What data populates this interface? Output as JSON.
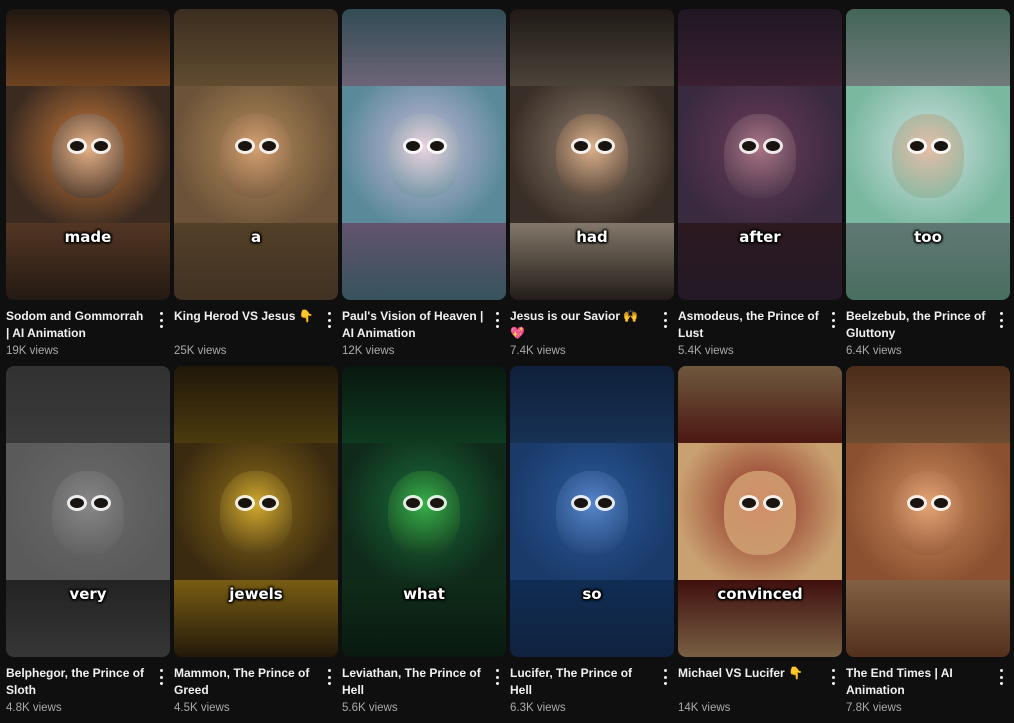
{
  "videos": [
    {
      "title": "Sodom and Gommorrah | AI Animation",
      "title_emoji": "",
      "views": "19K views",
      "caption": "made",
      "palette": [
        "#3a2a20",
        "#c97a3a",
        "#8a5a3a"
      ],
      "face": "#e8b890"
    },
    {
      "title": "King Herod VS Jesus",
      "title_emoji": "👇",
      "views": "25K views",
      "caption": "a",
      "palette": [
        "#6b5238",
        "#b08a58",
        "#8a6a44"
      ],
      "face": "#d9a373"
    },
    {
      "title": "Paul's Vision of Heaven | AI Animation",
      "title_emoji": "",
      "views": "12K views",
      "caption": "",
      "palette": [
        "#5a8a9a",
        "#c7b7d9",
        "#a58ab8"
      ],
      "face": "#f0d6e0"
    },
    {
      "title": "Jesus is our Savior",
      "title_emoji": "🙌 💖",
      "views": "7.4K views",
      "caption": "had",
      "palette": [
        "#3a2f28",
        "#8a7a6a",
        "#d9c7b0"
      ],
      "face": "#e6b890"
    },
    {
      "title": "Asmodeus, the Prince of Lust",
      "title_emoji": "",
      "views": "5.4K views",
      "caption": "after",
      "palette": [
        "#3a2a40",
        "#6a3a5a",
        "#4a2a35"
      ],
      "face": "#b07a8a"
    },
    {
      "title": "Beelzebub, the Prince of Gluttony",
      "title_emoji": "",
      "views": "6.4K views",
      "caption": "too",
      "palette": [
        "#7ab8a0",
        "#cfe0e0",
        "#a0c8c0"
      ],
      "face": "#e8b8a0"
    },
    {
      "title": "Belphegor, the Prince of Sloth",
      "title_emoji": "",
      "views": "4.8K views",
      "caption": "very",
      "palette": [
        "#5a5a5a",
        "#6a6a6a",
        "#3a3a3a"
      ],
      "face": "#8a8a8a"
    },
    {
      "title": "Mammon, The Prince of Greed",
      "title_emoji": "",
      "views": "4.5K views",
      "caption": "jewels",
      "palette": [
        "#3a2a10",
        "#8a6a18",
        "#c99a20"
      ],
      "face": "#d9b030"
    },
    {
      "title": "Leviathan, The Prince of Hell",
      "title_emoji": "",
      "views": "5.6K views",
      "caption": "what",
      "palette": [
        "#0f2a1a",
        "#1a6a3a",
        "#1a4a2a"
      ],
      "face": "#3ab84a"
    },
    {
      "title": "Lucifer, The Prince of Hell",
      "title_emoji": "",
      "views": "6.3K views",
      "caption": "so",
      "palette": [
        "#1a3a6a",
        "#2a5a9a",
        "#1a4a8a"
      ],
      "face": "#5a8ad0"
    },
    {
      "title": "Michael VS Lucifer",
      "title_emoji": "👇",
      "views": "14K views",
      "caption": "convinced",
      "palette": [
        "#c9a070",
        "#8a2a20",
        "#6a1a18"
      ],
      "face": "#d99a70"
    },
    {
      "title": "The End Times | AI Animation",
      "title_emoji": "",
      "views": "7.8K views",
      "caption": "",
      "palette": [
        "#8a5030",
        "#c98a5a",
        "#d9a070"
      ],
      "face": "#e8a878"
    }
  ],
  "icons": {
    "more": "more-vert-icon"
  },
  "colors": {
    "background": "#0f0f0f",
    "title": "#f1f1f1",
    "meta": "#aaaaaa"
  }
}
